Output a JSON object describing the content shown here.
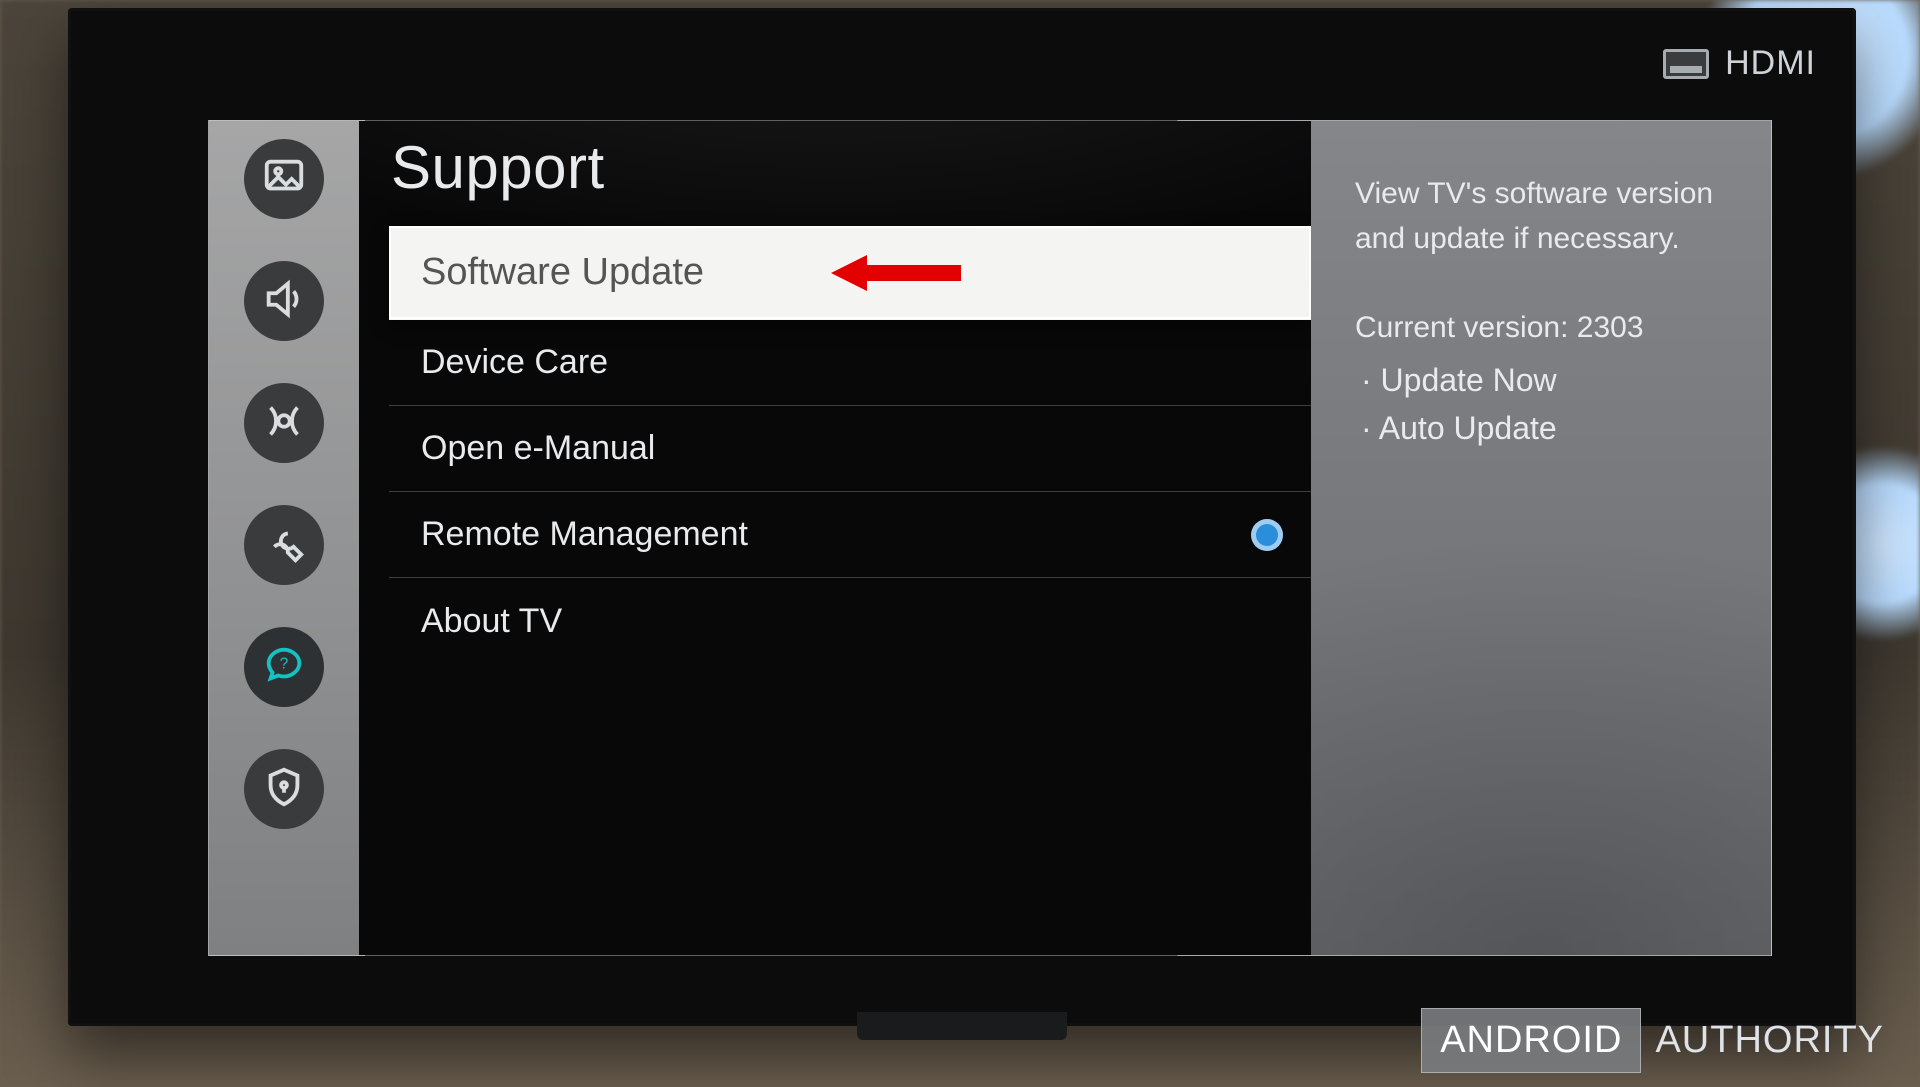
{
  "input": {
    "label": "HDMI"
  },
  "rail": {
    "items": [
      {
        "name": "picture",
        "active": false
      },
      {
        "name": "sound",
        "active": false
      },
      {
        "name": "broadcasting",
        "active": false
      },
      {
        "name": "general",
        "active": false
      },
      {
        "name": "support",
        "active": true
      },
      {
        "name": "privacy",
        "active": false
      }
    ]
  },
  "page": {
    "title": "Support"
  },
  "menu": {
    "items": [
      {
        "label": "Software Update",
        "selected": true,
        "indicator": false
      },
      {
        "label": "Device Care",
        "selected": false,
        "indicator": false
      },
      {
        "label": "Open e-Manual",
        "selected": false,
        "indicator": false
      },
      {
        "label": "Remote Management",
        "selected": false,
        "indicator": true
      },
      {
        "label": "About TV",
        "selected": false,
        "indicator": false
      }
    ]
  },
  "info": {
    "description": "View TV's software version and update if necessary.",
    "version_label": "Current version:",
    "version_value": "2303",
    "subactions": [
      "Update Now",
      "Auto Update"
    ]
  },
  "watermark": {
    "boxed": "ANDROID",
    "plain": "AUTHORITY"
  }
}
